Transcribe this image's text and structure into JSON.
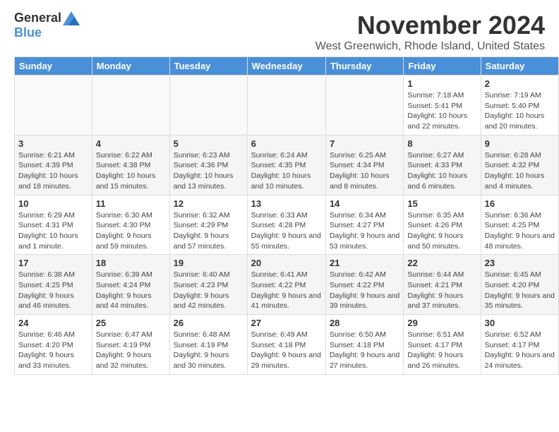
{
  "logo": {
    "general": "General",
    "blue": "Blue"
  },
  "title": "November 2024",
  "location": "West Greenwich, Rhode Island, United States",
  "days_header": [
    "Sunday",
    "Monday",
    "Tuesday",
    "Wednesday",
    "Thursday",
    "Friday",
    "Saturday"
  ],
  "weeks": [
    [
      {
        "day": "",
        "info": ""
      },
      {
        "day": "",
        "info": ""
      },
      {
        "day": "",
        "info": ""
      },
      {
        "day": "",
        "info": ""
      },
      {
        "day": "",
        "info": ""
      },
      {
        "day": "1",
        "info": "Sunrise: 7:18 AM\nSunset: 5:41 PM\nDaylight: 10 hours and 22 minutes."
      },
      {
        "day": "2",
        "info": "Sunrise: 7:19 AM\nSunset: 5:40 PM\nDaylight: 10 hours and 20 minutes."
      }
    ],
    [
      {
        "day": "3",
        "info": "Sunrise: 6:21 AM\nSunset: 4:39 PM\nDaylight: 10 hours and 18 minutes."
      },
      {
        "day": "4",
        "info": "Sunrise: 6:22 AM\nSunset: 4:38 PM\nDaylight: 10 hours and 15 minutes."
      },
      {
        "day": "5",
        "info": "Sunrise: 6:23 AM\nSunset: 4:36 PM\nDaylight: 10 hours and 13 minutes."
      },
      {
        "day": "6",
        "info": "Sunrise: 6:24 AM\nSunset: 4:35 PM\nDaylight: 10 hours and 10 minutes."
      },
      {
        "day": "7",
        "info": "Sunrise: 6:25 AM\nSunset: 4:34 PM\nDaylight: 10 hours and 8 minutes."
      },
      {
        "day": "8",
        "info": "Sunrise: 6:27 AM\nSunset: 4:33 PM\nDaylight: 10 hours and 6 minutes."
      },
      {
        "day": "9",
        "info": "Sunrise: 6:28 AM\nSunset: 4:32 PM\nDaylight: 10 hours and 4 minutes."
      }
    ],
    [
      {
        "day": "10",
        "info": "Sunrise: 6:29 AM\nSunset: 4:31 PM\nDaylight: 10 hours and 1 minute."
      },
      {
        "day": "11",
        "info": "Sunrise: 6:30 AM\nSunset: 4:30 PM\nDaylight: 9 hours and 59 minutes."
      },
      {
        "day": "12",
        "info": "Sunrise: 6:32 AM\nSunset: 4:29 PM\nDaylight: 9 hours and 57 minutes."
      },
      {
        "day": "13",
        "info": "Sunrise: 6:33 AM\nSunset: 4:28 PM\nDaylight: 9 hours and 55 minutes."
      },
      {
        "day": "14",
        "info": "Sunrise: 6:34 AM\nSunset: 4:27 PM\nDaylight: 9 hours and 53 minutes."
      },
      {
        "day": "15",
        "info": "Sunrise: 6:35 AM\nSunset: 4:26 PM\nDaylight: 9 hours and 50 minutes."
      },
      {
        "day": "16",
        "info": "Sunrise: 6:36 AM\nSunset: 4:25 PM\nDaylight: 9 hours and 48 minutes."
      }
    ],
    [
      {
        "day": "17",
        "info": "Sunrise: 6:38 AM\nSunset: 4:25 PM\nDaylight: 9 hours and 46 minutes."
      },
      {
        "day": "18",
        "info": "Sunrise: 6:39 AM\nSunset: 4:24 PM\nDaylight: 9 hours and 44 minutes."
      },
      {
        "day": "19",
        "info": "Sunrise: 6:40 AM\nSunset: 4:23 PM\nDaylight: 9 hours and 42 minutes."
      },
      {
        "day": "20",
        "info": "Sunrise: 6:41 AM\nSunset: 4:22 PM\nDaylight: 9 hours and 41 minutes."
      },
      {
        "day": "21",
        "info": "Sunrise: 6:42 AM\nSunset: 4:22 PM\nDaylight: 9 hours and 39 minutes."
      },
      {
        "day": "22",
        "info": "Sunrise: 6:44 AM\nSunset: 4:21 PM\nDaylight: 9 hours and 37 minutes."
      },
      {
        "day": "23",
        "info": "Sunrise: 6:45 AM\nSunset: 4:20 PM\nDaylight: 9 hours and 35 minutes."
      }
    ],
    [
      {
        "day": "24",
        "info": "Sunrise: 6:46 AM\nSunset: 4:20 PM\nDaylight: 9 hours and 33 minutes."
      },
      {
        "day": "25",
        "info": "Sunrise: 6:47 AM\nSunset: 4:19 PM\nDaylight: 9 hours and 32 minutes."
      },
      {
        "day": "26",
        "info": "Sunrise: 6:48 AM\nSunset: 4:19 PM\nDaylight: 9 hours and 30 minutes."
      },
      {
        "day": "27",
        "info": "Sunrise: 6:49 AM\nSunset: 4:18 PM\nDaylight: 9 hours and 29 minutes."
      },
      {
        "day": "28",
        "info": "Sunrise: 6:50 AM\nSunset: 4:18 PM\nDaylight: 9 hours and 27 minutes."
      },
      {
        "day": "29",
        "info": "Sunrise: 6:51 AM\nSunset: 4:17 PM\nDaylight: 9 hours and 26 minutes."
      },
      {
        "day": "30",
        "info": "Sunrise: 6:52 AM\nSunset: 4:17 PM\nDaylight: 9 hours and 24 minutes."
      }
    ]
  ]
}
